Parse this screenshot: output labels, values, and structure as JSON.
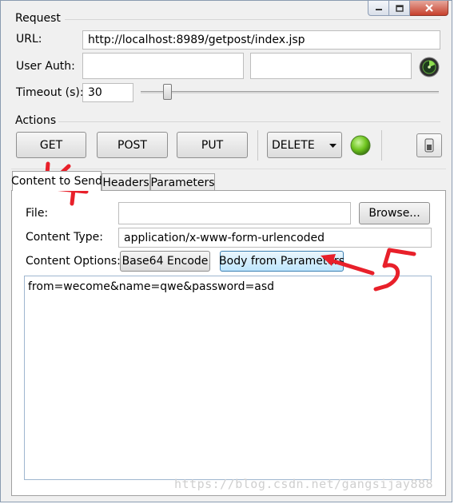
{
  "window": {
    "controls": [
      "minimize-icon",
      "maximize-icon",
      "close-icon"
    ]
  },
  "request": {
    "section_label": "Request",
    "url_label": "URL:",
    "url_value": "http://localhost:8989/getpost/index.jsp",
    "user_auth_label": "User Auth:",
    "user_value": "",
    "password_value": "",
    "timeout_label": "Timeout (s):",
    "timeout_value": "30"
  },
  "actions": {
    "section_label": "Actions",
    "get_label": "GET",
    "post_label": "POST",
    "put_label": "PUT",
    "method_select_value": "DELETE",
    "status_color": "#6fc51f"
  },
  "tabs": [
    {
      "label": "Content to Send",
      "active": true
    },
    {
      "label": "Headers",
      "active": false
    },
    {
      "label": "Parameters",
      "active": false
    }
  ],
  "content": {
    "file_label": "File:",
    "file_value": "",
    "browse_label": "Browse...",
    "content_type_label": "Content Type:",
    "content_type_value": "application/x-www-form-urlencoded",
    "content_options_label": "Content Options:",
    "base64_label": "Base64 Encode",
    "body_from_params_label": "Body from Parameters",
    "body_text": "from=wecome&name=qwe&password=asd"
  },
  "annotations": {
    "numbers": [
      "4",
      "5"
    ],
    "color": "#e8202a"
  },
  "watermark": "https://blog.csdn.net/gangsijay888"
}
